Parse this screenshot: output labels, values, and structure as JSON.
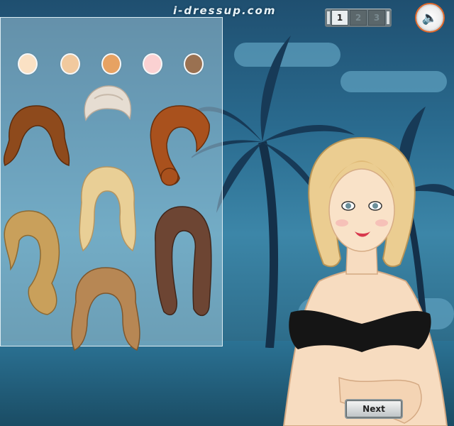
{
  "site": {
    "watermark": "i-dressup.com"
  },
  "steps": [
    {
      "label": "1",
      "active": true
    },
    {
      "label": "2",
      "active": false
    },
    {
      "label": "3",
      "active": false
    }
  ],
  "sound": {
    "icon": "speaker-icon",
    "glyph": "🔈"
  },
  "skin_tones": [
    "#fbe1c4",
    "#f1c99e",
    "#e7a262",
    "#fbd1d2",
    "#9a7151"
  ],
  "hairstyles": [
    {
      "name": "short-platinum-updo",
      "color": "#e6ddd2"
    },
    {
      "name": "wavy-auburn-shoulder",
      "color": "#8e4a1c"
    },
    {
      "name": "copper-curly-bun",
      "color": "#a9511d"
    },
    {
      "name": "blonde-curly-long",
      "color": "#e9cf96"
    },
    {
      "name": "golden-side-swept",
      "color": "#c9a05b"
    },
    {
      "name": "brown-braided-long",
      "color": "#6d4533"
    },
    {
      "name": "light-brown-curly",
      "color": "#b78754"
    }
  ],
  "next_button": {
    "label": "Next"
  }
}
